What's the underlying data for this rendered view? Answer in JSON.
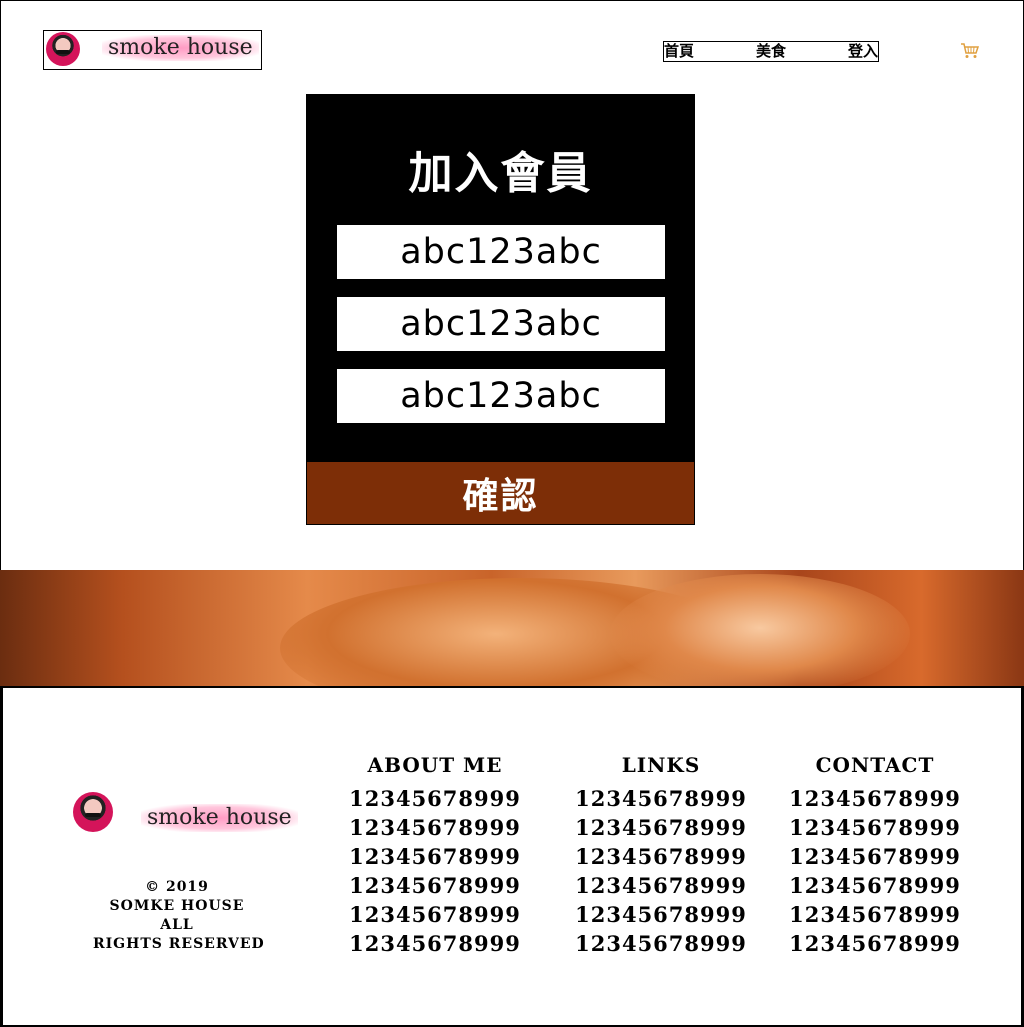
{
  "header": {
    "logo_text": "smoke house",
    "nav": [
      "首頁",
      "美食",
      "登入"
    ],
    "cart_icon": "shopping-cart-icon"
  },
  "signup": {
    "title": "加入會員",
    "fields": [
      "abc123abc",
      "abc123abc",
      "abc123abc"
    ],
    "confirm_label": "確認"
  },
  "footer": {
    "logo_text": "smoke house",
    "copyright": [
      "© 2019",
      "SOMKE HOUSE",
      "ALL",
      "RIGHTS RESERVED"
    ],
    "columns": [
      {
        "title": "ABOUT ME",
        "items": [
          "12345678999",
          "12345678999",
          "12345678999",
          "12345678999",
          "12345678999",
          "12345678999"
        ]
      },
      {
        "title": "LINKS",
        "items": [
          "12345678999",
          "12345678999",
          "12345678999",
          "12345678999",
          "12345678999",
          "12345678999"
        ]
      },
      {
        "title": "CONTACT",
        "items": [
          "12345678999",
          "12345678999",
          "12345678999",
          "12345678999",
          "12345678999",
          "12345678999"
        ]
      }
    ]
  },
  "colors": {
    "panel_bg": "#000000",
    "confirm_bg": "#7d2e07",
    "logo_highlight": "#ff9cc4",
    "cart_icon": "#e0a040"
  }
}
